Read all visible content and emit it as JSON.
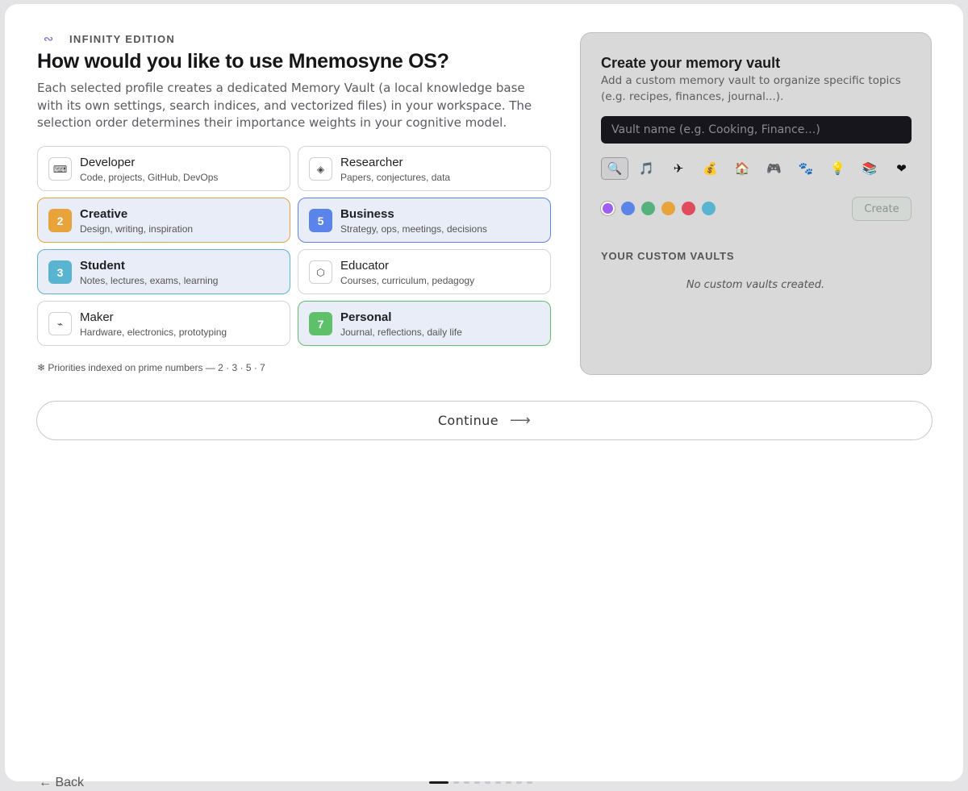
{
  "header": {
    "edition_icon": "∾",
    "edition_label": "INFINITY EDITION",
    "title": "How would you like to use Mnemosyne OS?",
    "description": "Each selected profile creates a dedicated Memory Vault (a local knowledge base with its own settings, search indices, and vectorized files) in your workspace. The selection order determines their importance weights in your cognitive model."
  },
  "profiles": [
    {
      "title": "Developer",
      "subtitle": "Code, projects, GitHub, DevOps",
      "icon": "keyboard-icon",
      "glyph": "⌨",
      "selected": false
    },
    {
      "title": "Researcher",
      "subtitle": "Papers, conjectures, data",
      "icon": "diamond-icon",
      "glyph": "◈",
      "selected": false
    },
    {
      "title": "Creative",
      "subtitle": "Design, writing, inspiration",
      "selected": true,
      "priority": "2",
      "color": "#e8a33b"
    },
    {
      "title": "Business",
      "subtitle": "Strategy, ops, meetings, decisions",
      "selected": true,
      "priority": "5",
      "color": "#5b84ea"
    },
    {
      "title": "Student",
      "subtitle": "Notes, lectures, exams, learning",
      "selected": true,
      "priority": "3",
      "color": "#58b4d1"
    },
    {
      "title": "Educator",
      "subtitle": "Courses, curriculum, pedagogy",
      "icon": "hexagon-icon",
      "glyph": "⬡",
      "selected": false
    },
    {
      "title": "Maker",
      "subtitle": "Hardware, electronics, prototyping",
      "icon": "circuit-icon",
      "glyph": "⌁",
      "selected": false
    },
    {
      "title": "Personal",
      "subtitle": "Journal, reflections, daily life",
      "selected": true,
      "priority": "7",
      "color": "#5fc06a"
    }
  ],
  "footnote": "❄ Priorities indexed on prime numbers — 2 · 3 · 5 · 7",
  "vault_panel": {
    "title": "Create your memory vault",
    "subtitle": "Add a custom memory vault to organize specific topics (e.g. recipes, finances, journal...).",
    "input_placeholder": "Vault name (e.g. Cooking, Finance…)",
    "input_value": "",
    "icon_options": [
      {
        "name": "search-icon",
        "glyph": "🔍",
        "active": true
      },
      {
        "name": "music-icon",
        "glyph": "🎵",
        "active": false
      },
      {
        "name": "plane-icon",
        "glyph": "✈",
        "active": false
      },
      {
        "name": "money-bag-icon",
        "glyph": "💰",
        "active": false
      },
      {
        "name": "house-icon",
        "glyph": "🏠",
        "active": false
      },
      {
        "name": "gamepad-icon",
        "glyph": "🎮",
        "active": false
      },
      {
        "name": "paw-icon",
        "glyph": "🐾",
        "active": false
      },
      {
        "name": "lightbulb-icon",
        "glyph": "💡",
        "active": false
      },
      {
        "name": "books-icon",
        "glyph": "📚",
        "active": false
      },
      {
        "name": "heart-icon",
        "glyph": "❤",
        "active": false
      }
    ],
    "color_options": [
      {
        "color": "#a15cf0",
        "active": true
      },
      {
        "color": "#5b84ea",
        "active": false
      },
      {
        "color": "#55b27d",
        "active": false
      },
      {
        "color": "#e8a33b",
        "active": false
      },
      {
        "color": "#e04c5d",
        "active": false
      },
      {
        "color": "#58b4d1",
        "active": false
      }
    ],
    "create_label": "Create",
    "custom_vaults_title": "YOUR CUSTOM VAULTS",
    "empty_message": "No custom vaults created."
  },
  "actions": {
    "continue_label": "Continue",
    "continue_arrow": "⟶",
    "back_label": "← Back"
  },
  "progress": {
    "steps": 9,
    "current": 1
  }
}
